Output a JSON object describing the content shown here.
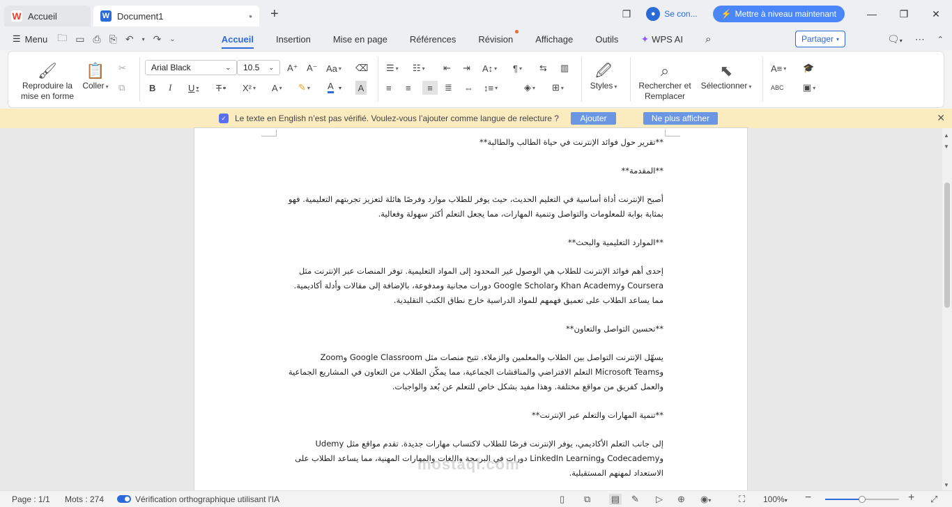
{
  "titlebar": {
    "home_tab": "Accueil",
    "doc_tab": "Document1",
    "doc_unsaved_dot": "•",
    "new_tab": "+",
    "signin": "Se con...",
    "upgrade": "Mettre à niveau maintenant"
  },
  "menubar": {
    "menu": "Menu",
    "tabs": [
      "Accueil",
      "Insertion",
      "Mise en page",
      "Références",
      "Révision",
      "Affichage",
      "Outils"
    ],
    "wps_ai": "WPS AI",
    "share": "Partager"
  },
  "ribbon": {
    "format_painter": "Reproduire la mise en forme",
    "paste": "Coller",
    "font_name": "Arial Black",
    "font_size": "10.5",
    "styles": "Styles",
    "find_replace": "Rechercher et Remplacer",
    "select": "Sélectionner"
  },
  "notification": {
    "message": "Le texte en English n’est pas vérifié. Voulez-vous l’ajouter comme langue de relecture ?",
    "add": "Ajouter",
    "dismiss": "Ne plus afficher"
  },
  "document": {
    "paragraphs": [
      "**تقرير حول فوائد الإنترنت في حياة الطالب والطالبة**",
      "**المقدمة**",
      "أصبح الإنترنت أداة أساسية في التعليم الحديث، حيث يوفر للطلاب موارد وفرصًا هائلة لتعزيز تجربتهم التعليمية. فهو بمثابة بوابة للمعلومات والتواصل وتنمية المهارات، مما يجعل التعلم أكثر سهولة وفعالية.",
      "**الموارد التعليمية والبحث**",
      "إحدى أهم فوائد الإنترنت للطلاب هي الوصول غير المحدود إلى المواد التعليمية. توفر المنصات عبر الإنترنت مثل Coursera وKhan Academy وGoogle Scholar دورات مجانية ومدفوعة، بالإضافة إلى مقالات وأدلة أكاديمية. مما يساعد الطلاب على تعميق فهمهم للمواد الدراسية خارج نطاق الكتب التقليدية.",
      "**تحسين التواصل والتعاون**",
      "يسهّل الإنترنت التواصل بين الطلاب والمعلمين والزملاء. تتيح منصات مثل Google Classroom وZoom وMicrosoft Teams التعلم الافتراضي والمناقشات الجماعية، مما يمكّن الطلاب من التعاون في المشاريع الجماعية والعمل كفريق من مواقع مختلفة. وهذا مفيد بشكل خاص للتعلم عن بُعد والواجبات.",
      "**تنمية المهارات والتعلم عبر الإنترنت**",
      "إلى جانب التعلم الأكاديمي، يوفر الإنترنت فرصًا للطلاب لاكتساب مهارات جديدة. تقدم مواقع مثل Udemy وCodecademy وLinkedIn Learning دورات في البرمجة واللغات والمهارات المهنية، مما يساعد الطلاب على الاستعداد لمهنهم المستقبلية."
    ],
    "watermark": "mostaql.com"
  },
  "statusbar": {
    "page": "Page : 1/1",
    "words": "Mots : 274",
    "spellcheck": "Vérification orthographique utilisant l'IA",
    "zoom": "100%",
    "zoom_level_fraction": 0.5
  },
  "colors": {
    "accent": "#2b6ad8",
    "upgrade": "#4a86f7",
    "notify_bg": "#fbecc0",
    "notify_btn": "#6b96e3"
  }
}
